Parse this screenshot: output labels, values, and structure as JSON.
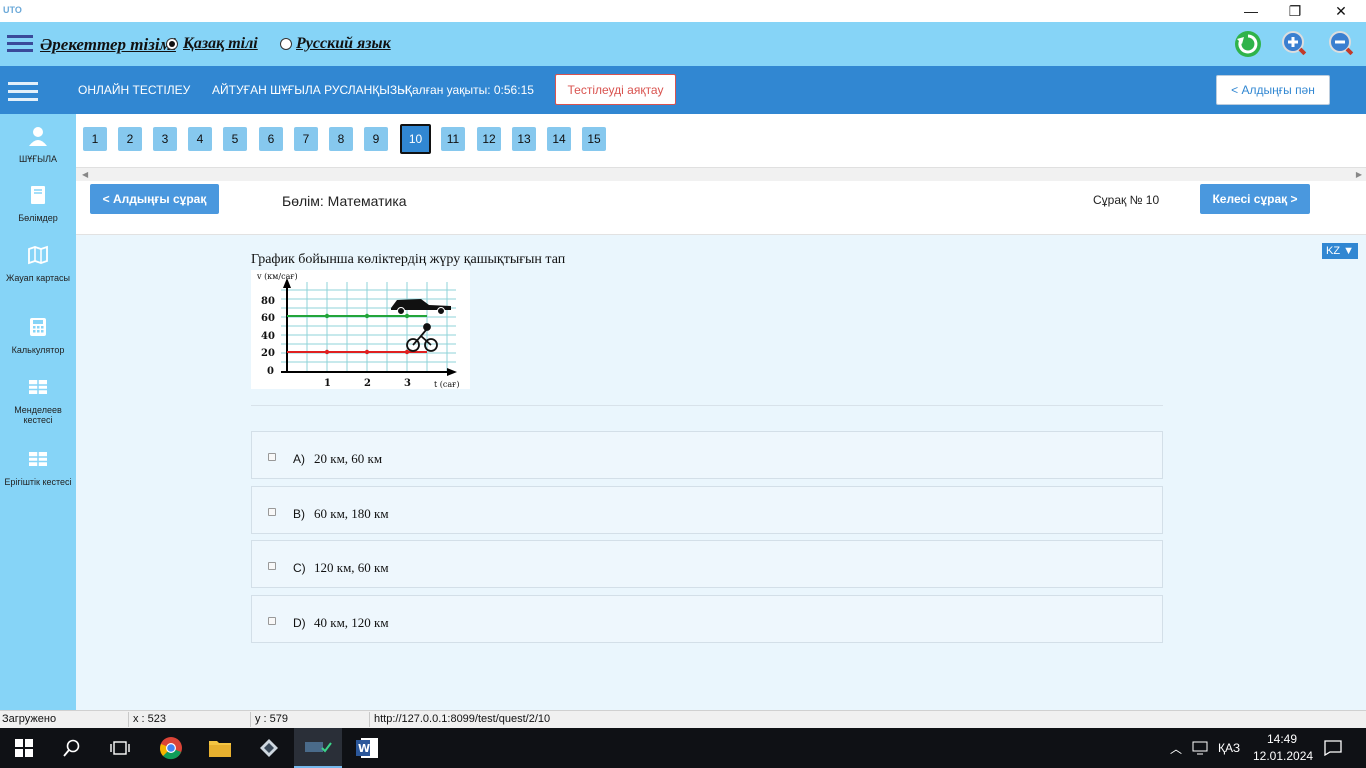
{
  "window": {
    "logo": "UTO",
    "minimize": "—",
    "maximize": "❐",
    "close": "✕"
  },
  "menubar": {
    "title": "Әрекеттер тізімі",
    "lang_kz": "Қазақ тілі",
    "lang_ru": "Русский язык",
    "selected_lang": "kz",
    "icons": [
      "refresh-icon",
      "zoom-in-icon",
      "zoom-out-icon"
    ]
  },
  "header": {
    "app_name": "ОНЛАЙН ТЕСТІЛЕУ",
    "student": "АЙТУҒАН ШҰҒЫЛА РУСЛАНҚЫЗЫ",
    "time_label": "-Қалған уақыты: 0:56:15",
    "finish_button": "Тестілеуді аяқтау",
    "prev_subject_button": "< Алдыңғы пән"
  },
  "sidebar": {
    "items": [
      {
        "label": "ШҰҒЫЛА",
        "icon": "user-icon"
      },
      {
        "label": "Бөлімдер",
        "icon": "book-icon"
      },
      {
        "label": "Жауап картасы",
        "icon": "map-icon"
      },
      {
        "label": "Калькулятор",
        "icon": "calculator-icon"
      },
      {
        "label": "Менделеев кестесі",
        "icon": "table-icon"
      },
      {
        "label": "Ерігіштік кестесі",
        "icon": "table-icon"
      }
    ]
  },
  "questions": {
    "numbers": [
      "1",
      "2",
      "3",
      "4",
      "5",
      "6",
      "7",
      "8",
      "9",
      "10",
      "11",
      "12",
      "13",
      "14",
      "15"
    ],
    "active": "10"
  },
  "question_header": {
    "prev_button": "< Алдыңғы сұрақ",
    "section": "Бөлім: Математика",
    "question_no": "Сұрақ № 10",
    "next_button": "Келесі сұрақ >"
  },
  "question": {
    "lang_select": "KZ",
    "text": "График бойынша көліктердің жүру қашықтығын тап",
    "graph": {
      "y_label": "v (км/сағ)",
      "x_label": "t (сағ)",
      "y_ticks": [
        "80",
        "60",
        "40",
        "20",
        "0"
      ],
      "x_ticks": [
        "1",
        "2",
        "3"
      ]
    },
    "answers": [
      {
        "letter": "A)",
        "text": "20 км, 60 км"
      },
      {
        "letter": "B)",
        "text": "60 км, 180 км"
      },
      {
        "letter": "C)",
        "text": "120 км, 60 км"
      },
      {
        "letter": "D)",
        "text": "40 км, 120 км"
      }
    ]
  },
  "statusbar": {
    "state": "Загружено",
    "x": "x : 523",
    "y": "y : 579",
    "url": "http://127.0.0.1:8099/test/quest/2/10"
  },
  "taskbar": {
    "lang": "ҚАЗ",
    "time": "14:49",
    "date": "12.01.2024"
  },
  "colors": {
    "menubar_bg": "#86d4f7",
    "header_bg": "#3187d2",
    "main_bg": "#eaf6fd",
    "danger": "#d9534f"
  }
}
